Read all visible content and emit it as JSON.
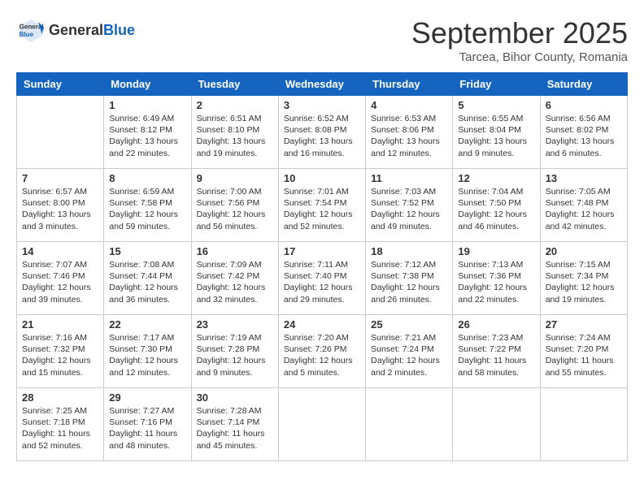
{
  "header": {
    "logo_general": "General",
    "logo_blue": "Blue",
    "month_title": "September 2025",
    "subtitle": "Tarcea, Bihor County, Romania"
  },
  "columns": [
    "Sunday",
    "Monday",
    "Tuesday",
    "Wednesday",
    "Thursday",
    "Friday",
    "Saturday"
  ],
  "weeks": [
    [
      {
        "day": "",
        "text": ""
      },
      {
        "day": "1",
        "text": "Sunrise: 6:49 AM\nSunset: 8:12 PM\nDaylight: 13 hours\nand 22 minutes."
      },
      {
        "day": "2",
        "text": "Sunrise: 6:51 AM\nSunset: 8:10 PM\nDaylight: 13 hours\nand 19 minutes."
      },
      {
        "day": "3",
        "text": "Sunrise: 6:52 AM\nSunset: 8:08 PM\nDaylight: 13 hours\nand 16 minutes."
      },
      {
        "day": "4",
        "text": "Sunrise: 6:53 AM\nSunset: 8:06 PM\nDaylight: 13 hours\nand 12 minutes."
      },
      {
        "day": "5",
        "text": "Sunrise: 6:55 AM\nSunset: 8:04 PM\nDaylight: 13 hours\nand 9 minutes."
      },
      {
        "day": "6",
        "text": "Sunrise: 6:56 AM\nSunset: 8:02 PM\nDaylight: 13 hours\nand 6 minutes."
      }
    ],
    [
      {
        "day": "7",
        "text": "Sunrise: 6:57 AM\nSunset: 8:00 PM\nDaylight: 13 hours\nand 3 minutes."
      },
      {
        "day": "8",
        "text": "Sunrise: 6:59 AM\nSunset: 7:58 PM\nDaylight: 12 hours\nand 59 minutes."
      },
      {
        "day": "9",
        "text": "Sunrise: 7:00 AM\nSunset: 7:56 PM\nDaylight: 12 hours\nand 56 minutes."
      },
      {
        "day": "10",
        "text": "Sunrise: 7:01 AM\nSunset: 7:54 PM\nDaylight: 12 hours\nand 52 minutes."
      },
      {
        "day": "11",
        "text": "Sunrise: 7:03 AM\nSunset: 7:52 PM\nDaylight: 12 hours\nand 49 minutes."
      },
      {
        "day": "12",
        "text": "Sunrise: 7:04 AM\nSunset: 7:50 PM\nDaylight: 12 hours\nand 46 minutes."
      },
      {
        "day": "13",
        "text": "Sunrise: 7:05 AM\nSunset: 7:48 PM\nDaylight: 12 hours\nand 42 minutes."
      }
    ],
    [
      {
        "day": "14",
        "text": "Sunrise: 7:07 AM\nSunset: 7:46 PM\nDaylight: 12 hours\nand 39 minutes."
      },
      {
        "day": "15",
        "text": "Sunrise: 7:08 AM\nSunset: 7:44 PM\nDaylight: 12 hours\nand 36 minutes."
      },
      {
        "day": "16",
        "text": "Sunrise: 7:09 AM\nSunset: 7:42 PM\nDaylight: 12 hours\nand 32 minutes."
      },
      {
        "day": "17",
        "text": "Sunrise: 7:11 AM\nSunset: 7:40 PM\nDaylight: 12 hours\nand 29 minutes."
      },
      {
        "day": "18",
        "text": "Sunrise: 7:12 AM\nSunset: 7:38 PM\nDaylight: 12 hours\nand 26 minutes."
      },
      {
        "day": "19",
        "text": "Sunrise: 7:13 AM\nSunset: 7:36 PM\nDaylight: 12 hours\nand 22 minutes."
      },
      {
        "day": "20",
        "text": "Sunrise: 7:15 AM\nSunset: 7:34 PM\nDaylight: 12 hours\nand 19 minutes."
      }
    ],
    [
      {
        "day": "21",
        "text": "Sunrise: 7:16 AM\nSunset: 7:32 PM\nDaylight: 12 hours\nand 15 minutes."
      },
      {
        "day": "22",
        "text": "Sunrise: 7:17 AM\nSunset: 7:30 PM\nDaylight: 12 hours\nand 12 minutes."
      },
      {
        "day": "23",
        "text": "Sunrise: 7:19 AM\nSunset: 7:28 PM\nDaylight: 12 hours\nand 9 minutes."
      },
      {
        "day": "24",
        "text": "Sunrise: 7:20 AM\nSunset: 7:26 PM\nDaylight: 12 hours\nand 5 minutes."
      },
      {
        "day": "25",
        "text": "Sunrise: 7:21 AM\nSunset: 7:24 PM\nDaylight: 12 hours\nand 2 minutes."
      },
      {
        "day": "26",
        "text": "Sunrise: 7:23 AM\nSunset: 7:22 PM\nDaylight: 11 hours\nand 58 minutes."
      },
      {
        "day": "27",
        "text": "Sunrise: 7:24 AM\nSunset: 7:20 PM\nDaylight: 11 hours\nand 55 minutes."
      }
    ],
    [
      {
        "day": "28",
        "text": "Sunrise: 7:25 AM\nSunset: 7:18 PM\nDaylight: 11 hours\nand 52 minutes."
      },
      {
        "day": "29",
        "text": "Sunrise: 7:27 AM\nSunset: 7:16 PM\nDaylight: 11 hours\nand 48 minutes."
      },
      {
        "day": "30",
        "text": "Sunrise: 7:28 AM\nSunset: 7:14 PM\nDaylight: 11 hours\nand 45 minutes."
      },
      {
        "day": "",
        "text": ""
      },
      {
        "day": "",
        "text": ""
      },
      {
        "day": "",
        "text": ""
      },
      {
        "day": "",
        "text": ""
      }
    ]
  ]
}
